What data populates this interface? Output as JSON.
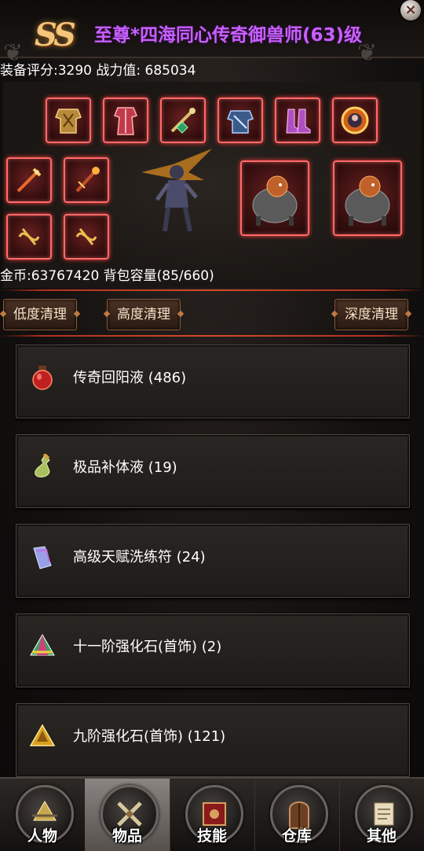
{
  "header": {
    "vip_badge": "SS",
    "title": "至尊*四海同心传奇御兽师(63)级",
    "close_label": "×"
  },
  "stats": {
    "text": "装备评分:3290 战力值: 685034"
  },
  "equipment": {
    "slots": [
      {
        "icon": "golden-armor-icon"
      },
      {
        "icon": "crimson-robe-icon"
      },
      {
        "icon": "jade-weapon-icon"
      },
      {
        "icon": "steel-armor-icon"
      },
      {
        "icon": "purple-boots-icon"
      },
      {
        "icon": "pet-medallion-icon"
      },
      {
        "icon": "fire-sword-icon"
      },
      {
        "icon": "fire-staff-icon"
      },
      {
        "icon": "gold-rune-icon"
      },
      {
        "icon": "gold-rune-icon"
      },
      {
        "icon": "beast-mount-icon"
      },
      {
        "icon": "beast-mount-icon"
      }
    ],
    "hero": "hero-character-icon"
  },
  "inventory": {
    "text": "金币:63767420 背包容量(85/660)"
  },
  "cleanup": {
    "low": "低度清理",
    "high": "高度清理",
    "deep": "深度清理"
  },
  "items": [
    {
      "label": "传奇回阳液 (486)",
      "icon": "red-potion-icon"
    },
    {
      "label": "极品补体液 (19)",
      "icon": "green-potion-icon"
    },
    {
      "label": "高级天赋洗练符 (24)",
      "icon": "crystal-scroll-icon"
    },
    {
      "label": "十一阶强化石(首饰) (2)",
      "icon": "rainbow-gem-icon"
    },
    {
      "label": "九阶强化石(首饰) (121)",
      "icon": "gold-gem-icon"
    }
  ],
  "nav": {
    "tabs": [
      {
        "label": "人物",
        "icon": "character-emblem-icon",
        "active": false
      },
      {
        "label": "物品",
        "icon": "crossed-swords-icon",
        "active": true
      },
      {
        "label": "技能",
        "icon": "skill-book-icon",
        "active": false
      },
      {
        "label": "仓库",
        "icon": "warehouse-door-icon",
        "active": false
      },
      {
        "label": "其他",
        "icon": "scroll-icon",
        "active": false
      }
    ]
  }
}
